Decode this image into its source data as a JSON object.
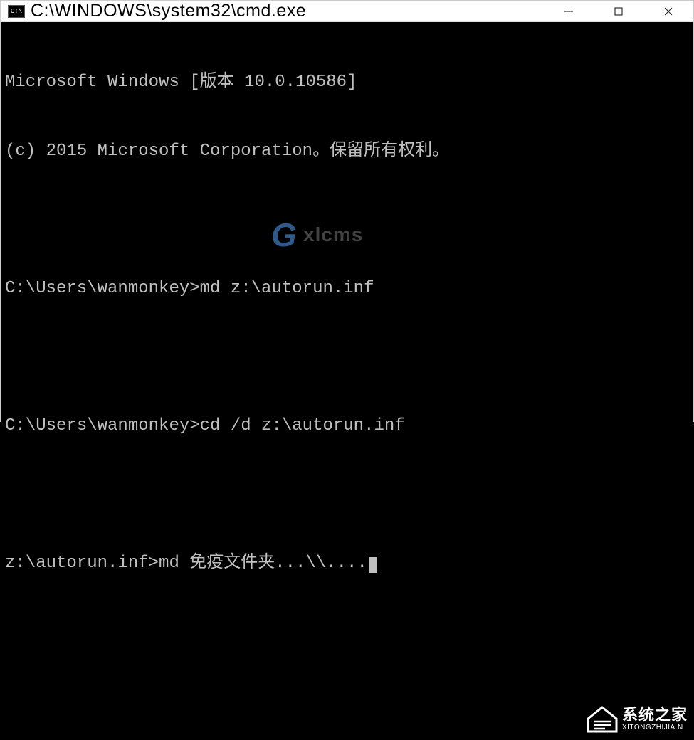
{
  "window": {
    "icon_label": "C:\\",
    "title": "C:\\WINDOWS\\system32\\cmd.exe"
  },
  "console": {
    "lines": [
      "Microsoft Windows [版本 10.0.10586]",
      "(c) 2015 Microsoft Corporation。保留所有权利。",
      "",
      "C:\\Users\\wanmonkey>md z:\\autorun.inf",
      "",
      "C:\\Users\\wanmonkey>cd /d z:\\autorun.inf",
      "",
      "z:\\autorun.inf>md 免疫文件夹...\\\\...."
    ]
  },
  "watermark": {
    "g": "G",
    "text": "xlcms"
  },
  "bottom_logo": {
    "main": "系统之家",
    "sub": "XITONGZHIJIA.N"
  }
}
